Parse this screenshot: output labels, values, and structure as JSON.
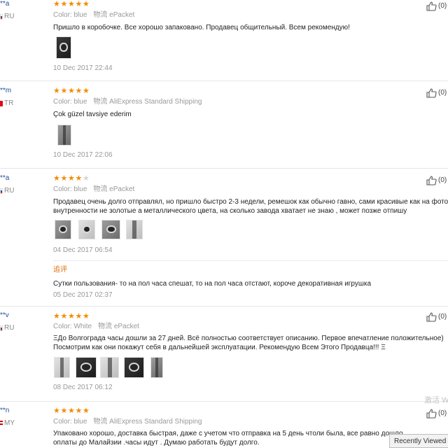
{
  "reviews": [
    {
      "user": "**a",
      "country": "RU",
      "stars": 5,
      "color_label": "Color:",
      "color": "blue",
      "shipping_label": "物流",
      "shipping": "ePacket",
      "text": [
        "Пришло в коробочке. Все хорошо запаковано. Продавец общительный. Всем рекомендую!"
      ],
      "date": "10 Dec 2017 22:44",
      "likes": "(0)"
    },
    {
      "user": "**m",
      "country": "TR",
      "stars": 5,
      "color_label": "Color:",
      "color": "blue",
      "shipping_label": "物流",
      "shipping": "AliExpress Standard Shipping",
      "text": [
        "Çok güzel tavsiye ederim"
      ],
      "date": "10 Dec 2017 22:06",
      "likes": "(0)"
    },
    {
      "user": "**a",
      "country": "RU",
      "stars": 4,
      "color_label": "Color:",
      "color": "blue",
      "shipping_label": "物流",
      "shipping": "ePacket",
      "text": [
        "Продавец очень долго отправлял, но пришло быстро 2-3 недели, ремешок как обычно гавно, сами красивые как на фото,",
        "внутренности не золотые а металлического цвета, на сколько завода хватает не знаю , может позже отпишу"
      ],
      "date": "04 Dec 2017 06:54",
      "followup": {
        "label": "追评",
        "text": "Сутки пользования- то на пол часа спешат, то на пол часа отстают, короче декоративная игрушка",
        "date": "05 Dec 2017 02:37"
      },
      "likes": "(0)"
    },
    {
      "user": "**v",
      "country": "RU",
      "stars": 5,
      "color_label": "Color:",
      "color": "White",
      "shipping_label": "物流",
      "shipping": "ePacket",
      "text": [
        "ΞДо Волгограда часы дошли за 27 дней. Всё полностью соответствует описанию. Первое впечатление положительное)",
        "Посмотрим как они покажут себя в дальнейшей эксплуатации. Рекомендую Всем Этого Продавца!!! Ξ"
      ],
      "date": "08 Dec 2017 06:12",
      "likes": "(0)"
    },
    {
      "user": "**n",
      "country": "MY",
      "stars": 5,
      "color_label": "Color:",
      "color": "blue",
      "shipping_label": "物流",
      "shipping": "AliExpress Standard Shipping",
      "text": [
        "Упаковано хорошо, доставка быстрая, даже с учетом что отправка на 5 день чтоли была, все равно дошло",
        "оплаты до Малайзии .часы идут . Думаю работать будут долго."
      ],
      "likes": "(0)"
    }
  ],
  "watermark": "激活 W",
  "recently_viewed": "Recently Viewed",
  "colors": {
    "star": "#f28c00",
    "username": "#1f4f9a",
    "followup_label": "#e0700a",
    "meta_text": "#999999"
  }
}
